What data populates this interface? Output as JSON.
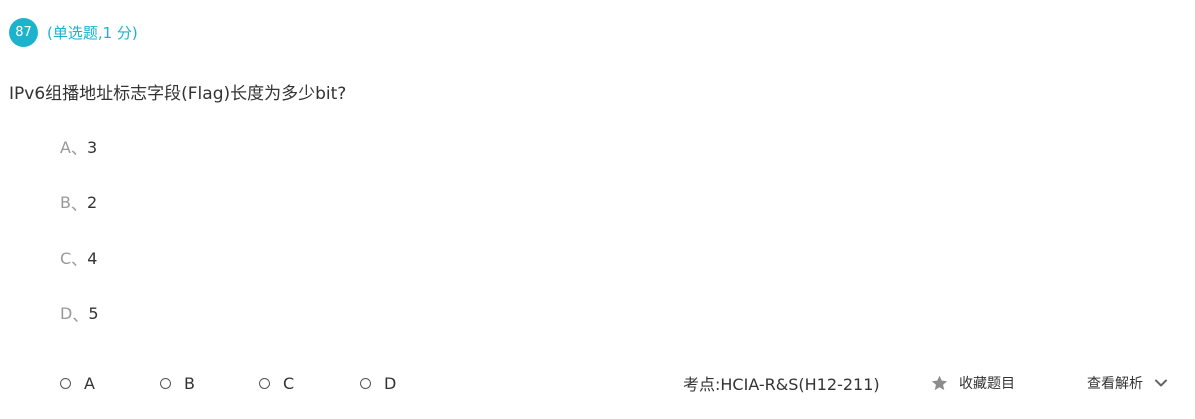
{
  "question": {
    "number": "87",
    "type_label": "(单选题,1 分)",
    "text": "IPv6组播地址标志字段(Flag)长度为多少bit?"
  },
  "options": [
    {
      "letter": "A",
      "sep": "、",
      "text": "3"
    },
    {
      "letter": "B",
      "sep": "、",
      "text": "2"
    },
    {
      "letter": "C",
      "sep": "、",
      "text": "4"
    },
    {
      "letter": "D",
      "sep": "、",
      "text": "5"
    }
  ],
  "answer_choices": [
    "A",
    "B",
    "C",
    "D"
  ],
  "footer": {
    "topic": "考点:HCIA-R&S(H12-211)",
    "favorite_label": "收藏题目",
    "favorite_icon": "star-icon",
    "analysis_label": "查看解析",
    "analysis_icon": "chevron-down-icon"
  },
  "colors": {
    "accent": "#1bb4cc",
    "text": "#333333",
    "muted": "#999999",
    "icon": "#8c8c8c"
  }
}
